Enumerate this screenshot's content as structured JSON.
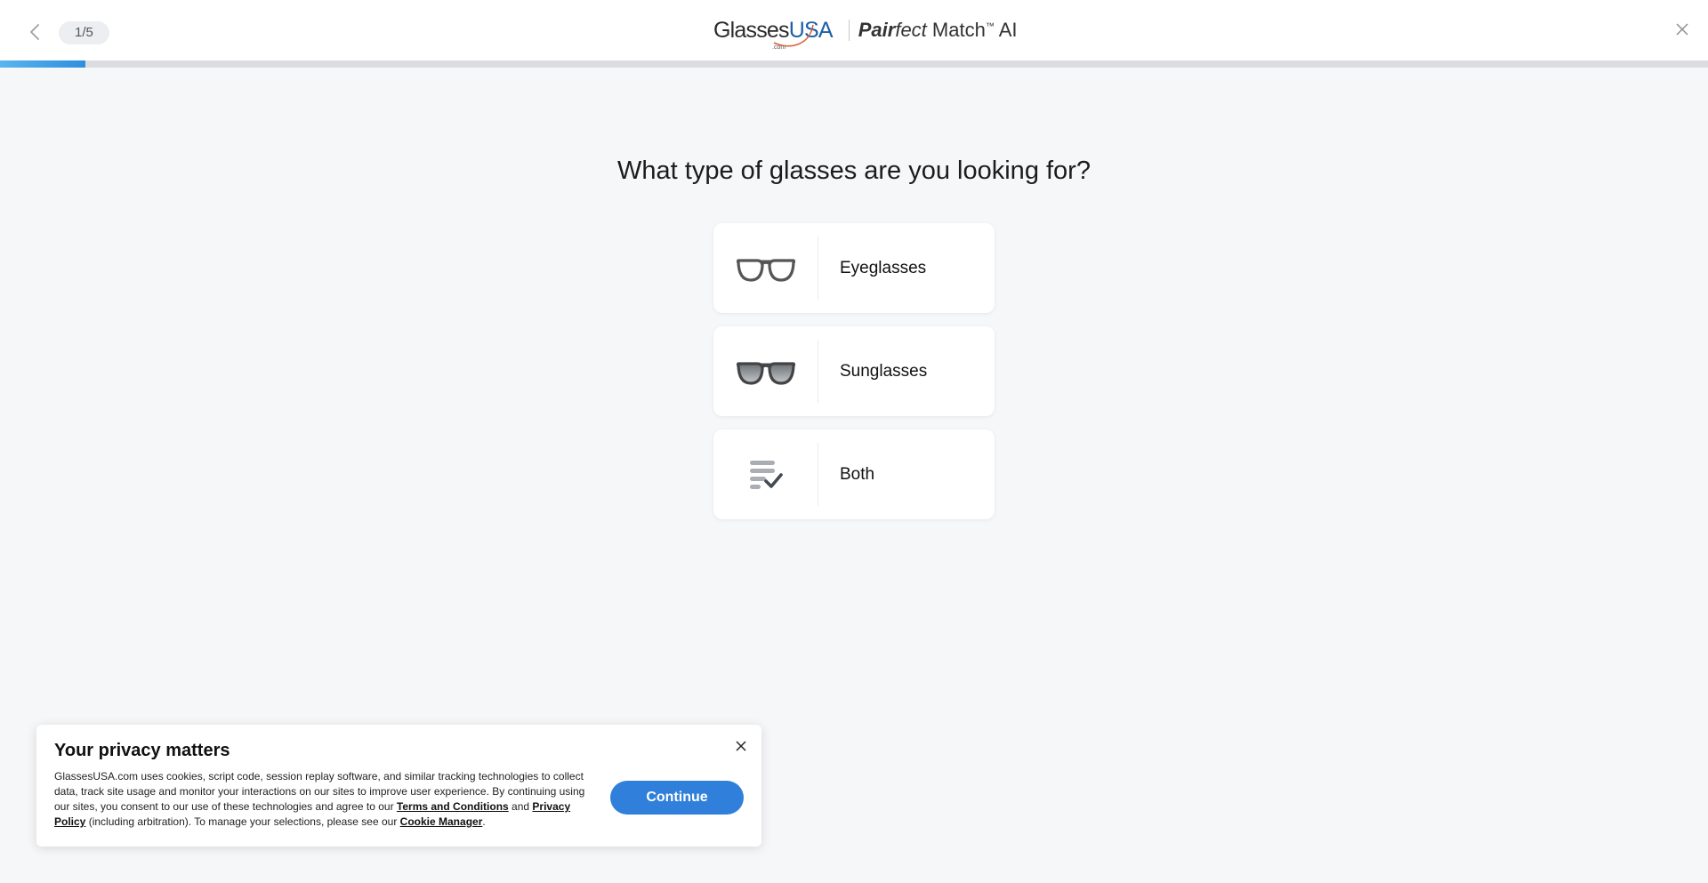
{
  "header": {
    "back_icon": "chevron-left-icon",
    "step_label": "1/5",
    "brand_part1": "Glasses",
    "brand_part2": "USA",
    "brand_dotcom": ".com",
    "product_pair": "Pair",
    "product_fect": "fect",
    "product_match": " Match",
    "product_tm": "™",
    "product_ai": " AI",
    "close_icon": "close-icon"
  },
  "progress": {
    "fraction": 0.05,
    "color": "#3a9ae6"
  },
  "quiz": {
    "question": "What type of glasses are you looking for?",
    "options": [
      {
        "label": "Eyeglasses",
        "icon": "eyeglasses-icon"
      },
      {
        "label": "Sunglasses",
        "icon": "sunglasses-icon"
      },
      {
        "label": "Both",
        "icon": "list-check-icon"
      }
    ]
  },
  "privacy": {
    "title": "Your privacy matters",
    "text_1": "GlassesUSA.com uses cookies, script code, session replay software, and similar tracking technologies to collect data, track site usage and monitor your interactions on our sites to improve user experience. By continuing using our sites, you consent to our use of these technologies and agree to our ",
    "link_terms": "Terms and Conditions",
    "text_2": " and ",
    "link_privacy": "Privacy Policy",
    "text_3": " (including arbitration). To manage your selections, please see our ",
    "link_cookie": "Cookie Manager",
    "text_4": ".",
    "continue_label": "Continue",
    "accent_color": "#2f7fdb"
  }
}
